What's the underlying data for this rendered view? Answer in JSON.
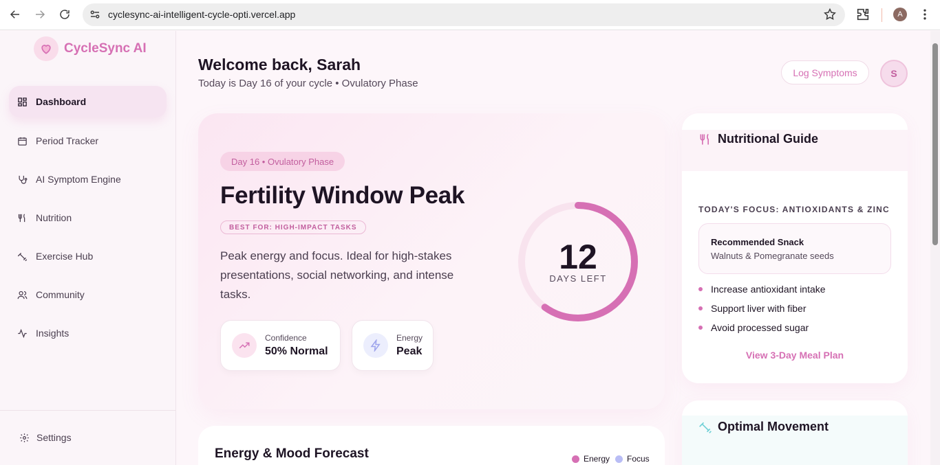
{
  "browser": {
    "url": "cyclesync-ai-intelligent-cycle-opti.vercel.app",
    "profile_initial": "A"
  },
  "sidebar": {
    "brand": "CycleSync AI",
    "items": [
      {
        "label": "Dashboard",
        "icon": "dashboard-icon"
      },
      {
        "label": "Period Tracker",
        "icon": "calendar-icon"
      },
      {
        "label": "AI Symptom Engine",
        "icon": "stethoscope-icon"
      },
      {
        "label": "Nutrition",
        "icon": "utensils-icon"
      },
      {
        "label": "Exercise Hub",
        "icon": "dumbbell-icon"
      },
      {
        "label": "Community",
        "icon": "users-icon"
      },
      {
        "label": "Insights",
        "icon": "activity-icon"
      }
    ],
    "settings": "Settings"
  },
  "header": {
    "welcome": "Welcome back, Sarah",
    "subtitle": "Today is Day 16 of your cycle • Ovulatory Phase",
    "log_button": "Log Symptoms",
    "avatar_initial": "S"
  },
  "hero": {
    "phase_pill": "Day 16 • Ovulatory Phase",
    "title": "Fertility Window Peak",
    "best_for": "BEST FOR: HIGH-IMPACT TASKS",
    "description": "Peak energy and focus. Ideal for high-stakes presentations, social networking, and intense tasks.",
    "stats": [
      {
        "label": "Confidence",
        "value": "50% Normal"
      },
      {
        "label": "Energy",
        "value": "Peak"
      }
    ],
    "days_left": "12",
    "days_left_label": "DAYS LEFT",
    "ring_progress": 0.6
  },
  "forecast": {
    "title": "Energy & Mood Forecast",
    "legend": [
      {
        "label": "Energy",
        "color": "#d670b4"
      },
      {
        "label": "Focus",
        "color": "#b9bdf5"
      }
    ]
  },
  "nutrition": {
    "title": "Nutritional Guide",
    "focus": "TODAY'S FOCUS: ANTIOXIDANTS & ZINC",
    "snack_title": "Recommended Snack",
    "snack_value": "Walnuts & Pomegranate seeds",
    "bullets": [
      "Increase antioxidant intake",
      "Support liver with fiber",
      "Avoid processed sugar"
    ],
    "link": "View 3-Day Meal Plan"
  },
  "movement": {
    "title": "Optimal Movement"
  },
  "colors": {
    "accent": "#d670b4",
    "accent_soft": "#f7d3e6",
    "text": "#1e1424"
  }
}
